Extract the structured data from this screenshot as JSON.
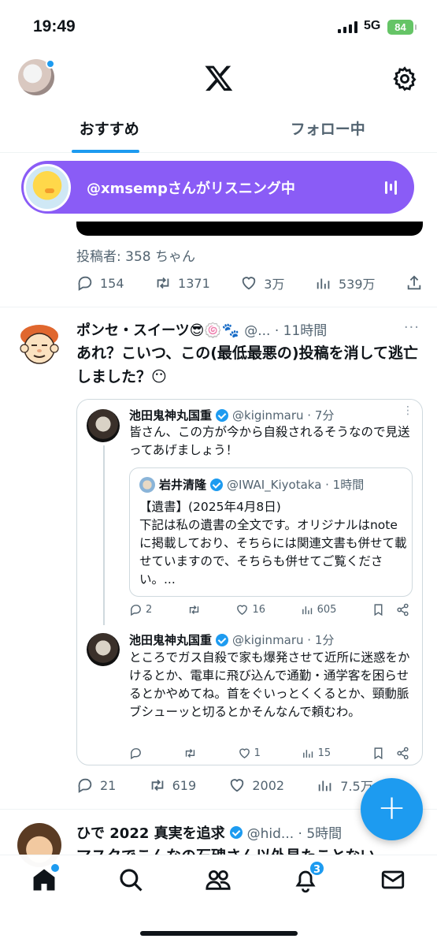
{
  "status_bar": {
    "time": "19:49",
    "network": "5G",
    "battery": "84"
  },
  "header": {
    "tabs": [
      {
        "label": "おすすめ",
        "active": true
      },
      {
        "label": "フォロー中",
        "active": false
      }
    ]
  },
  "spaces_pill": {
    "text": "@xmsempさんがリスニング中",
    "color": "#8a5cf6"
  },
  "prev_post": {
    "poster": "投稿者: 358 ちゃん",
    "stats": {
      "replies": "154",
      "reposts": "1371",
      "likes": "3万",
      "views": "539万"
    }
  },
  "post1": {
    "name": "ポンセ・スイーツ😎🍥🐾",
    "handle_time": "@... · 11時間",
    "text": "あれ？こいつ、この(最低最悪の)投稿を消して逃亡しました？😶",
    "stats": {
      "replies": "21",
      "reposts": "619",
      "likes": "2002",
      "views": "7.5万"
    },
    "quote": {
      "first": {
        "name": "池田鬼神丸国重",
        "handle_time": "@kiginmaru · 7分",
        "text": "皆さん、この方が今から自殺されるそうなので見送ってあげましょう！",
        "stats": {
          "replies": "2",
          "reposts": "",
          "likes": "16",
          "views": "605"
        }
      },
      "inner": {
        "name": "岩井清隆",
        "handle_time": "@IWAI_Kiyotaka · 1時間",
        "text": "【遺書】(2025年4月8日)\n下記は私の遺書の全文です。オリジナルはnoteに掲載しており、そちらには関連文書も併せて載せていますので、そちらも併せてご覧ください。..."
      },
      "second": {
        "name": "池田鬼神丸国重",
        "handle_time": "@kiginmaru · 1分",
        "text": "ところでガス自殺で家も爆発させて近所に迷惑をかけるとか、電車に飛び込んで通勤・通学客を困らせるとかやめてね。首をぐいっとくくるとか、頸動脈ブシューッと切るとかそんなんで頼むわ。",
        "stats": {
          "replies": "",
          "reposts": "",
          "likes": "1",
          "views": "15"
        }
      }
    }
  },
  "post2": {
    "name": "ひで 2022 真実を追求",
    "handle_time": "@hid... · 5時間",
    "text": "マスクでこんなの石碑さん以外見たことない"
  },
  "fab_label": "+",
  "bottom_nav": {
    "notifications_badge": "3"
  },
  "colors": {
    "accent": "#1d9bf0",
    "text_secondary": "#536471"
  }
}
